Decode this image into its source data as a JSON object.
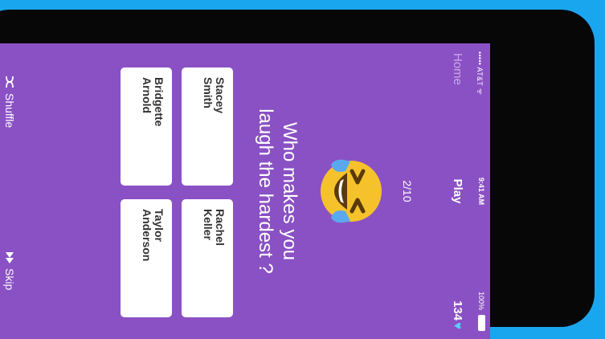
{
  "status": {
    "carrier": "••••• AT&T ᯤ",
    "time": "9:41 AM",
    "battery": "100%"
  },
  "nav": {
    "home": "Home",
    "title": "Play",
    "coins": "134",
    "coin_icon": "heart-icon"
  },
  "game": {
    "counter": "2/10",
    "question_line1": "Who makes you",
    "question_line2": "laugh the hardest ?",
    "options": [
      {
        "first": "Stacey",
        "last": "Smith"
      },
      {
        "first": "Rachel",
        "last": "Keller"
      },
      {
        "first": "Bridgette",
        "last": "Arnold"
      },
      {
        "first": "Taylor",
        "last": "Anderson"
      }
    ]
  },
  "footer": {
    "shuffle": "Shuffle",
    "skip": "Skip"
  },
  "colors": {
    "background": "#1aa6ef",
    "screen": "#8a51c4",
    "phone": "#070707",
    "emoji_face": "#f6c22b",
    "tears": "#5aa9ef"
  }
}
